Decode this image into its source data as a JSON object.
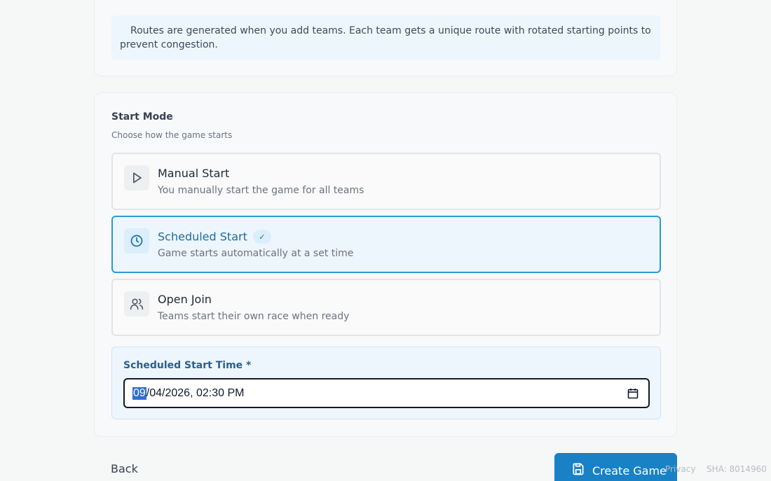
{
  "info": {
    "text_line1": "Routes are generated when you add teams. Each team gets a unique route with rotated starting points to",
    "text_line2": "prevent congestion."
  },
  "start_mode": {
    "title": "Start Mode",
    "subtitle": "Choose how the game starts",
    "options": [
      {
        "title": "Manual Start",
        "description": "You manually start the game for all teams",
        "icon": "play-icon",
        "selected": false
      },
      {
        "title": "Scheduled Start",
        "description": "Game starts automatically at a set time",
        "icon": "clock-icon",
        "selected": true,
        "badge": "✓"
      },
      {
        "title": "Open Join",
        "description": "Teams start their own race when ready",
        "icon": "users-icon",
        "selected": false
      }
    ]
  },
  "schedule": {
    "label": "Scheduled Start Time *",
    "value_month": "09",
    "value_rest": "/04/2026, 02:30 PM"
  },
  "footer": {
    "back_label": "Back",
    "create_label": "Create Game",
    "privacy_label": "Privacy",
    "sha_label": "SHA: 8014960"
  },
  "colors": {
    "accent": "#1981c6",
    "selected_border": "#2a9ad6",
    "info_bg": "#eef6fd"
  }
}
